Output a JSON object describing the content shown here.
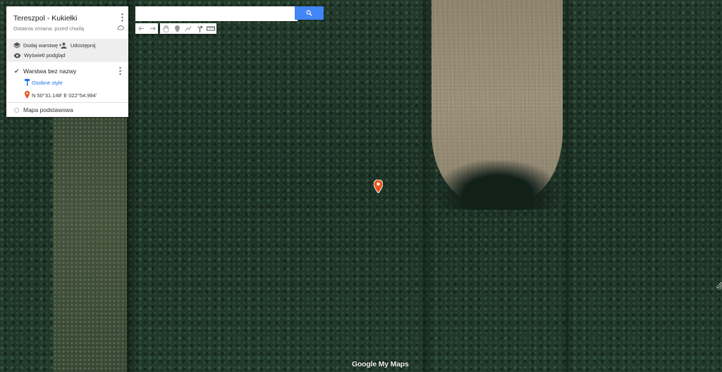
{
  "map": {
    "title": "Tereszpol - Kukiełki",
    "subtitle": "Ostatnia zmiana: przed chwilą",
    "actions": {
      "add_layer": "Dodaj warstwę",
      "share": "Udostępnij",
      "preview": "Wyświetl podgląd"
    },
    "layer": {
      "name": "Warstwa bez nazwy",
      "style": "Osobne style",
      "place": "N 50°31.148' E 022°54.994'"
    },
    "base_map": "Mapa podstawowa"
  },
  "search": {
    "value": "",
    "placeholder": ""
  },
  "footer": {
    "brand": "Google My Maps"
  },
  "edge_label": "Str",
  "colors": {
    "accent": "#4285f4",
    "marker": "#e8541e",
    "link": "#1a73e8"
  },
  "icons": [
    "kebab-menu-icon",
    "cloud-icon",
    "layers-icon",
    "add-person-icon",
    "eye-icon",
    "check-icon",
    "paint-roller-icon",
    "pin-icon",
    "search-icon",
    "undo-icon",
    "redo-icon",
    "hand-icon",
    "marker-icon",
    "line-icon",
    "directions-icon",
    "ruler-icon"
  ]
}
